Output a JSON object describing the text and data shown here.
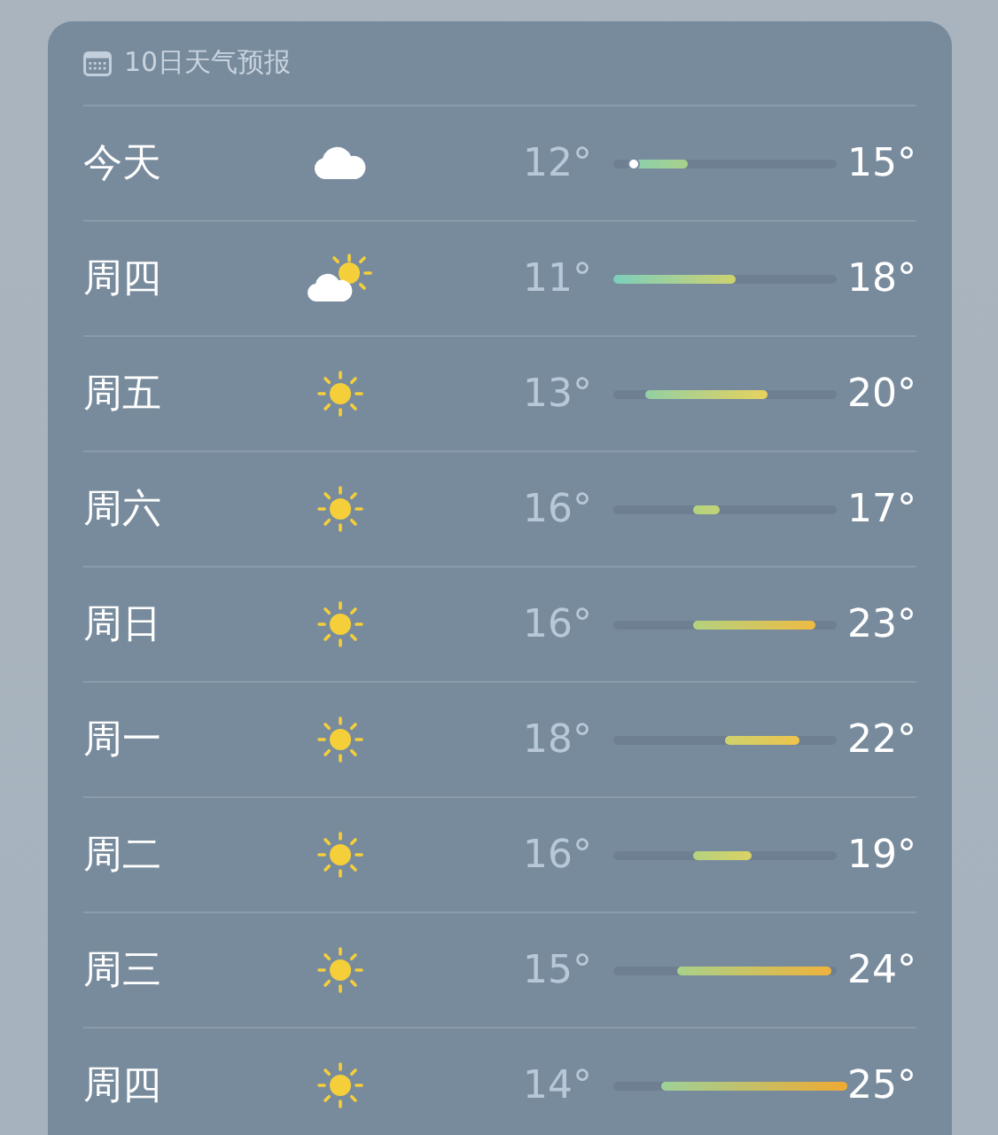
{
  "title": "10日天气预报",
  "days": [
    {
      "day": "今天",
      "kind": "cloudy",
      "low": "12°",
      "high": "15°",
      "current_dot": true
    },
    {
      "day": "周四",
      "kind": "partly_cloudy",
      "low": "11°",
      "high": "18°",
      "current_dot": false
    },
    {
      "day": "周五",
      "kind": "sunny",
      "low": "13°",
      "high": "20°",
      "current_dot": false
    },
    {
      "day": "周六",
      "kind": "sunny",
      "low": "16°",
      "high": "17°",
      "current_dot": false
    },
    {
      "day": "周日",
      "kind": "sunny",
      "low": "16°",
      "high": "23°",
      "current_dot": false
    },
    {
      "day": "周一",
      "kind": "sunny",
      "low": "18°",
      "high": "22°",
      "current_dot": false
    },
    {
      "day": "周二",
      "kind": "sunny",
      "low": "16°",
      "high": "19°",
      "current_dot": false
    },
    {
      "day": "周三",
      "kind": "sunny",
      "low": "15°",
      "high": "24°",
      "current_dot": false
    },
    {
      "day": "周四",
      "kind": "sunny",
      "low": "14°",
      "high": "25°",
      "current_dot": false
    }
  ]
}
